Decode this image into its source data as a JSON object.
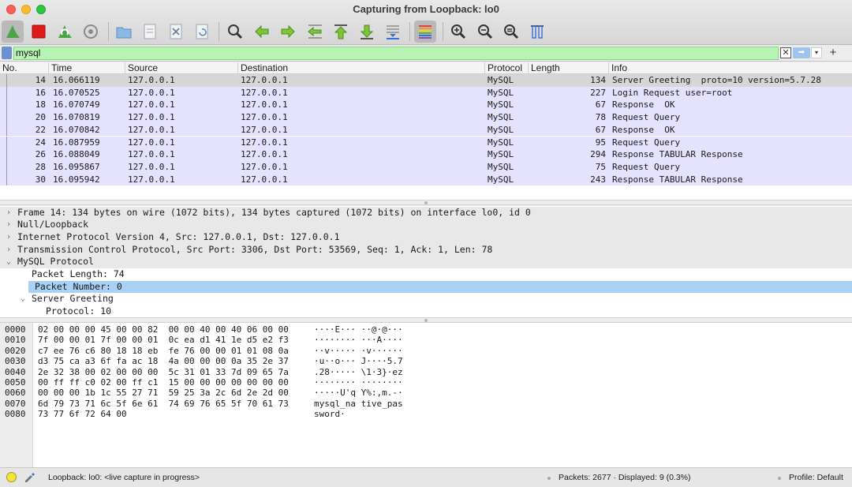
{
  "window": {
    "title": "Capturing from Loopback: lo0"
  },
  "toolbar": {
    "buttons": [
      {
        "icon": "shark-fin-start-icon",
        "label": "Start capture"
      },
      {
        "icon": "stop-square-icon",
        "label": "Stop capture"
      },
      {
        "icon": "shark-fin-restart-icon",
        "label": "Restart capture"
      },
      {
        "icon": "gear-icon",
        "label": "Capture options"
      },
      {
        "icon": "folder-icon",
        "label": "Open"
      },
      {
        "icon": "document-icon",
        "label": "Save"
      },
      {
        "icon": "close-document-icon",
        "label": "Close"
      },
      {
        "icon": "reload-icon",
        "label": "Reload"
      },
      {
        "icon": "search-icon",
        "label": "Find packet"
      },
      {
        "icon": "arrow-left-icon",
        "label": "Previous packet"
      },
      {
        "icon": "arrow-right-icon",
        "label": "Next packet"
      },
      {
        "icon": "go-to-packet-icon",
        "label": "Go to packet"
      },
      {
        "icon": "arrow-up-first-icon",
        "label": "First packet"
      },
      {
        "icon": "arrow-down-last-icon",
        "label": "Last packet"
      },
      {
        "icon": "autoscroll-icon",
        "label": "Auto scroll"
      },
      {
        "icon": "colorize-icon",
        "label": "Colorize"
      },
      {
        "icon": "zoom-in-icon",
        "label": "Zoom in"
      },
      {
        "icon": "zoom-out-icon",
        "label": "Zoom out"
      },
      {
        "icon": "zoom-reset-icon",
        "label": "Normal size"
      },
      {
        "icon": "resize-columns-icon",
        "label": "Resize columns"
      }
    ]
  },
  "filter": {
    "value": "mysql",
    "clear_glyph": "✕",
    "apply_glyph": "➡",
    "dropdown_glyph": "▾",
    "add_glyph": "+"
  },
  "packet_list": {
    "columns": [
      "No.",
      "Time",
      "Source",
      "Destination",
      "Protocol",
      "Length",
      "Info"
    ],
    "rows": [
      {
        "no": "14",
        "time": "16.066119",
        "source": "127.0.0.1",
        "destination": "127.0.0.1",
        "protocol": "MySQL",
        "length": "134",
        "info": "Server Greeting  proto=10 version=5.7.28",
        "selected": true
      },
      {
        "no": "16",
        "time": "16.070525",
        "source": "127.0.0.1",
        "destination": "127.0.0.1",
        "protocol": "MySQL",
        "length": "227",
        "info": "Login Request user=root",
        "selected": false
      },
      {
        "no": "18",
        "time": "16.070749",
        "source": "127.0.0.1",
        "destination": "127.0.0.1",
        "protocol": "MySQL",
        "length": "67",
        "info": "Response  OK",
        "selected": false
      },
      {
        "no": "20",
        "time": "16.070819",
        "source": "127.0.0.1",
        "destination": "127.0.0.1",
        "protocol": "MySQL",
        "length": "78",
        "info": "Request Query",
        "selected": false
      },
      {
        "no": "22",
        "time": "16.070842",
        "source": "127.0.0.1",
        "destination": "127.0.0.1",
        "protocol": "MySQL",
        "length": "67",
        "info": "Response  OK",
        "selected": false
      },
      {
        "no": "24",
        "time": "16.087959",
        "source": "127.0.0.1",
        "destination": "127.0.0.1",
        "protocol": "MySQL",
        "length": "95",
        "info": "Request Query",
        "selected": false
      },
      {
        "no": "26",
        "time": "16.088049",
        "source": "127.0.0.1",
        "destination": "127.0.0.1",
        "protocol": "MySQL",
        "length": "294",
        "info": "Response TABULAR Response",
        "selected": false
      },
      {
        "no": "28",
        "time": "16.095867",
        "source": "127.0.0.1",
        "destination": "127.0.0.1",
        "protocol": "MySQL",
        "length": "75",
        "info": "Request Query",
        "selected": false
      },
      {
        "no": "30",
        "time": "16.095942",
        "source": "127.0.0.1",
        "destination": "127.0.0.1",
        "protocol": "MySQL",
        "length": "243",
        "info": "Response TABULAR Response",
        "selected": false
      }
    ],
    "row_color": "#e4e2ff"
  },
  "details": {
    "rows": [
      {
        "indent": 0,
        "arrow": "›",
        "text": "Frame 14: 134 bytes on wire (1072 bits), 134 bytes captured (1072 bits) on interface lo0, id 0",
        "style": "top"
      },
      {
        "indent": 0,
        "arrow": "›",
        "text": "Null/Loopback",
        "style": "top"
      },
      {
        "indent": 0,
        "arrow": "›",
        "text": "Internet Protocol Version 4, Src: 127.0.0.1, Dst: 127.0.0.1",
        "style": "top"
      },
      {
        "indent": 0,
        "arrow": "›",
        "text": "Transmission Control Protocol, Src Port: 3306, Dst Port: 53569, Seq: 1, Ack: 1, Len: 78",
        "style": "top"
      },
      {
        "indent": 0,
        "arrow": "⌄",
        "text": "MySQL Protocol",
        "style": "top"
      },
      {
        "indent": 1,
        "arrow": "",
        "text": "Packet Length: 74",
        "style": "plain"
      },
      {
        "indent": 1,
        "arrow": "",
        "text": "Packet Number: 0",
        "style": "hl"
      },
      {
        "indent": 1,
        "arrow": "⌄",
        "text": "Server Greeting",
        "style": "plain"
      },
      {
        "indent": 2,
        "arrow": "",
        "text": "Protocol: 10",
        "style": "plain"
      }
    ]
  },
  "bytes": {
    "offsets": [
      "0000",
      "0010",
      "0020",
      "0030",
      "0040",
      "0050",
      "0060",
      "0070",
      "0080"
    ],
    "hex": [
      "02 00 00 00 45 00 00 82  00 00 40 00 40 06 00 00",
      "7f 00 00 01 7f 00 00 01  0c ea d1 41 1e d5 e2 f3",
      "c7 ee 76 c6 80 18 18 eb  fe 76 00 00 01 01 08 0a",
      "d3 75 ca a3 6f fa ac 18  4a 00 00 00 0a 35 2e 37",
      "2e 32 38 00 02 00 00 00  5c 31 01 33 7d 09 65 7a",
      "00 ff ff c0 02 00 ff c1  15 00 00 00 00 00 00 00",
      "00 00 00 1b 1c 55 27 71  59 25 3a 2c 6d 2e 2d 00",
      "6d 79 73 71 6c 5f 6e 61  74 69 76 65 5f 70 61 73",
      "73 77 6f 72 64 00"
    ],
    "ascii": [
      "····E··· ··@·@···",
      "········ ···A····",
      "··v····· ·v······",
      "·u··o··· J····5.7",
      ".28····· \\1·3}·ez",
      "········ ········",
      "·····U'q Y%:,m.-·",
      "mysql_na tive_pas",
      "sword·"
    ]
  },
  "status": {
    "left": "Loopback: lo0: <live capture in progress>",
    "middle": "Packets: 2677 · Displayed: 9 (0.3%)",
    "right": "Profile: Default"
  }
}
